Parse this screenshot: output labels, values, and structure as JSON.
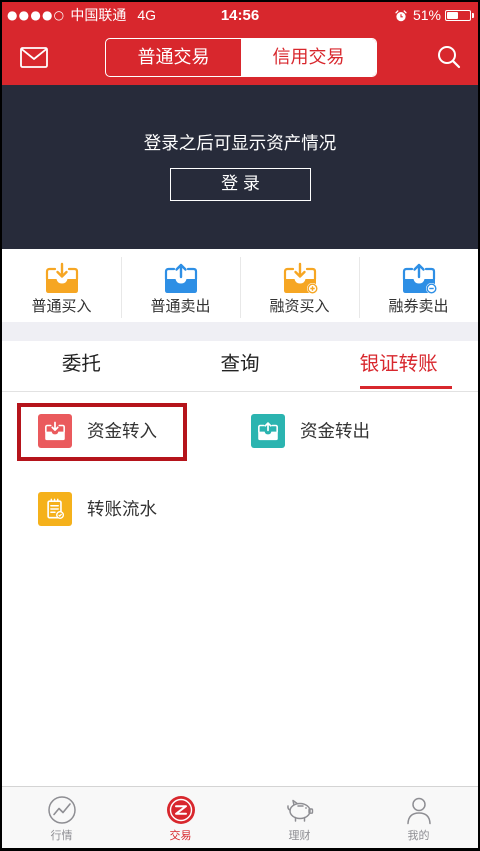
{
  "colors": {
    "brand_red": "#d8272d",
    "navy": "#272b3a",
    "buy_orange": "#f6a623",
    "sell_blue": "#2e8fe5",
    "transfer_in_red": "#ea5a5d",
    "transfer_out_teal": "#2bb4b0",
    "ledger_yellow": "#f5b11b",
    "highlight_border": "#b5141b",
    "inactive_gray": "#8e8e93",
    "gap_gray": "#efeff4"
  },
  "status_bar": {
    "signal": "●●●●○",
    "carrier": "中国联通",
    "network": "4G",
    "time": "14:56",
    "alarm_icon": "alarm-clock-icon",
    "battery": "51%"
  },
  "header": {
    "left_icon": "mail-icon",
    "right_icon": "search-icon",
    "segments": [
      {
        "label": "普通交易",
        "selected": false
      },
      {
        "label": "信用交易",
        "selected": true
      }
    ]
  },
  "login_panel": {
    "message": "登录之后可显示资产情况",
    "button_label": "登 录"
  },
  "quick_actions": [
    {
      "label": "普通买入",
      "icon": "tray-download-icon",
      "color": "#f6a623"
    },
    {
      "label": "普通卖出",
      "icon": "tray-upload-icon",
      "color": "#2e8fe5"
    },
    {
      "label": "融资买入",
      "icon": "tray-download-plus-icon",
      "color": "#f6a623"
    },
    {
      "label": "融券卖出",
      "icon": "tray-upload-minus-icon",
      "color": "#2e8fe5"
    }
  ],
  "tabs": [
    {
      "label": "委托",
      "selected": false
    },
    {
      "label": "查询",
      "selected": false
    },
    {
      "label": "银证转账",
      "selected": true
    }
  ],
  "transfer_items": [
    {
      "label": "资金转入",
      "icon": "transfer-in-icon",
      "color": "#ea5a5d",
      "highlighted": true
    },
    {
      "label": "资金转出",
      "icon": "transfer-out-icon",
      "color": "#2bb4b0",
      "highlighted": false
    },
    {
      "label": "转账流水",
      "icon": "ledger-icon",
      "color": "#f5b11b",
      "highlighted": false
    }
  ],
  "bottom_nav": [
    {
      "label": "行情",
      "icon": "market-chart-icon",
      "active": false
    },
    {
      "label": "交易",
      "icon": "trade-icon",
      "active": true
    },
    {
      "label": "理财",
      "icon": "piggy-bank-icon",
      "active": false
    },
    {
      "label": "我的",
      "icon": "user-icon",
      "active": false
    }
  ]
}
